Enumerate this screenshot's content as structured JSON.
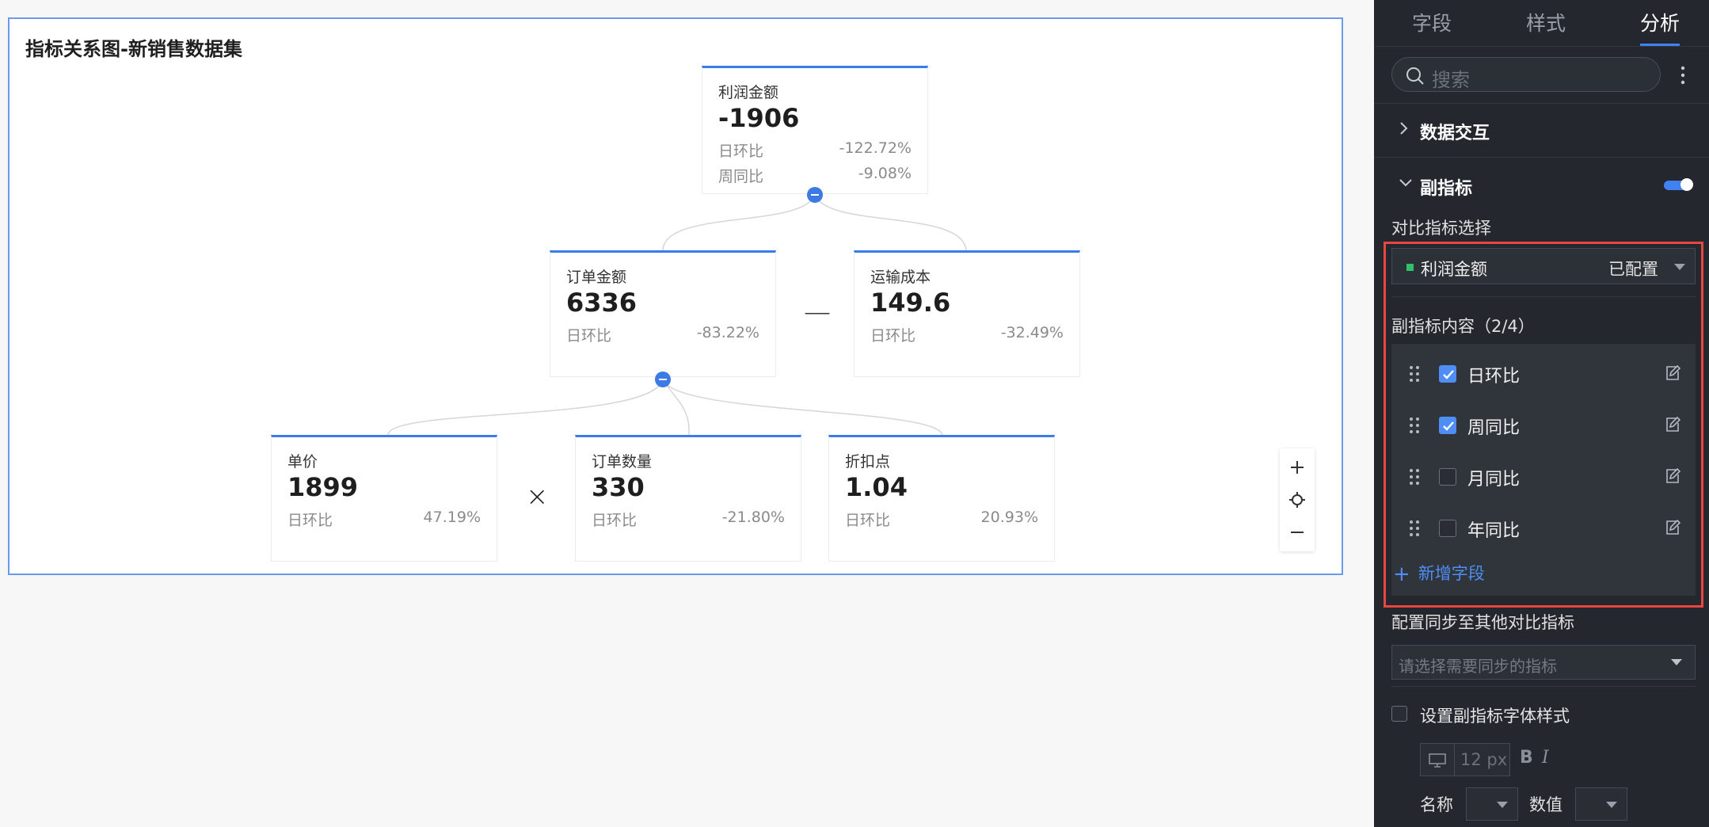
{
  "canvas": {
    "title": "指标关系图-新销售数据集",
    "operators": {
      "minus": "—",
      "times": "×"
    },
    "nodes": [
      {
        "name": "利润金额",
        "value": "-1906",
        "rows": [
          {
            "label": "日环比",
            "value": "-122.72%"
          },
          {
            "label": "周同比",
            "value": "-9.08%"
          }
        ]
      },
      {
        "name": "订单金额",
        "value": "6336",
        "rows": [
          {
            "label": "日环比",
            "value": "-83.22%"
          }
        ]
      },
      {
        "name": "运输成本",
        "value": "149.6",
        "rows": [
          {
            "label": "日环比",
            "value": "-32.49%"
          }
        ]
      },
      {
        "name": "单价",
        "value": "1899",
        "rows": [
          {
            "label": "日环比",
            "value": "47.19%"
          }
        ]
      },
      {
        "name": "订单数量",
        "value": "330",
        "rows": [
          {
            "label": "日环比",
            "value": "-21.80%"
          }
        ]
      },
      {
        "name": "折扣点",
        "value": "1.04",
        "rows": [
          {
            "label": "日环比",
            "value": "20.93%"
          }
        ]
      }
    ],
    "zoom_controls": [
      "zoom-in-icon",
      "locate-icon",
      "zoom-out-icon"
    ]
  },
  "panel": {
    "tabs": [
      "字段",
      "样式",
      "分析"
    ],
    "active_tab": "分析",
    "search_placeholder": "搜索",
    "section_interaction": "数据交互",
    "section_sub_metric": "副指标",
    "sub_metric_enabled": true,
    "compare_label": "对比指标选择",
    "compare_metric": {
      "name": "利润金额",
      "status": "已配置",
      "color": "#2ec26a"
    },
    "content_label": "副指标内容（2/4）",
    "items": [
      {
        "label": "日环比",
        "checked": true
      },
      {
        "label": "周同比",
        "checked": true
      },
      {
        "label": "月同比",
        "checked": false
      },
      {
        "label": "年同比",
        "checked": false
      }
    ],
    "add_field": "新增字段",
    "sync_label": "配置同步至其他对比指标",
    "sync_placeholder": "请选择需要同步的指标",
    "font_style_label": "设置副指标字体样式",
    "font_size": "12",
    "font_unit": "px",
    "bold": "B",
    "italic": "I",
    "name_label": "名称",
    "value_label": "数值",
    "accent_color": "#3f82f0"
  }
}
